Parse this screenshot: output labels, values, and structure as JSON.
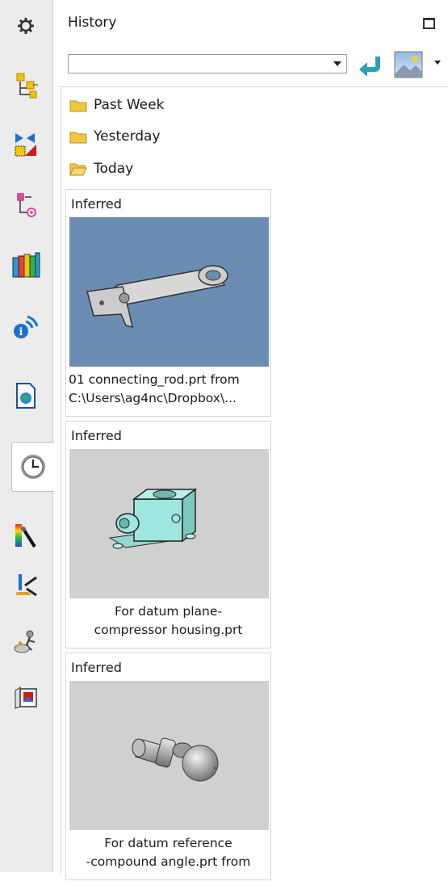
{
  "panel": {
    "title": "History",
    "history_select_value": ""
  },
  "folders": [
    {
      "label": "Past Week",
      "icon": "folder-icon"
    },
    {
      "label": "Yesterday",
      "icon": "folder-icon"
    },
    {
      "label": "Today",
      "icon": "folder-open-icon"
    }
  ],
  "cards": [
    {
      "tag": "Inferred",
      "caption_line1": "01 connecting_rod.prt from",
      "caption_line2": "C:\\Users\\ag4nc\\Dropbox\\...",
      "thumb_bg": "#6b8db3"
    },
    {
      "tag": "Inferred",
      "caption_line1": "For datum plane-",
      "caption_line2": "compressor housing.prt",
      "thumb_bg": "#d0d0d0"
    },
    {
      "tag": "Inferred",
      "caption_line1": "For datum reference",
      "caption_line2": "-compound angle.prt from",
      "thumb_bg": "#d0d0d0"
    }
  ],
  "sidebar_icons": [
    "gear-icon",
    "assembly-navigator-icon",
    "constraint-navigator-icon",
    "part-navigator-icon",
    "reuse-library-icon",
    "hd3d-tools-icon",
    "web-browser-icon",
    "history-icon",
    "process-studio-icon",
    "manufacturing-wizard-icon",
    "roles-icon",
    "system-scenes-icon"
  ],
  "colors": {
    "accent_teal": "#2aa0b5",
    "folder_yellow": "#f2c744"
  }
}
